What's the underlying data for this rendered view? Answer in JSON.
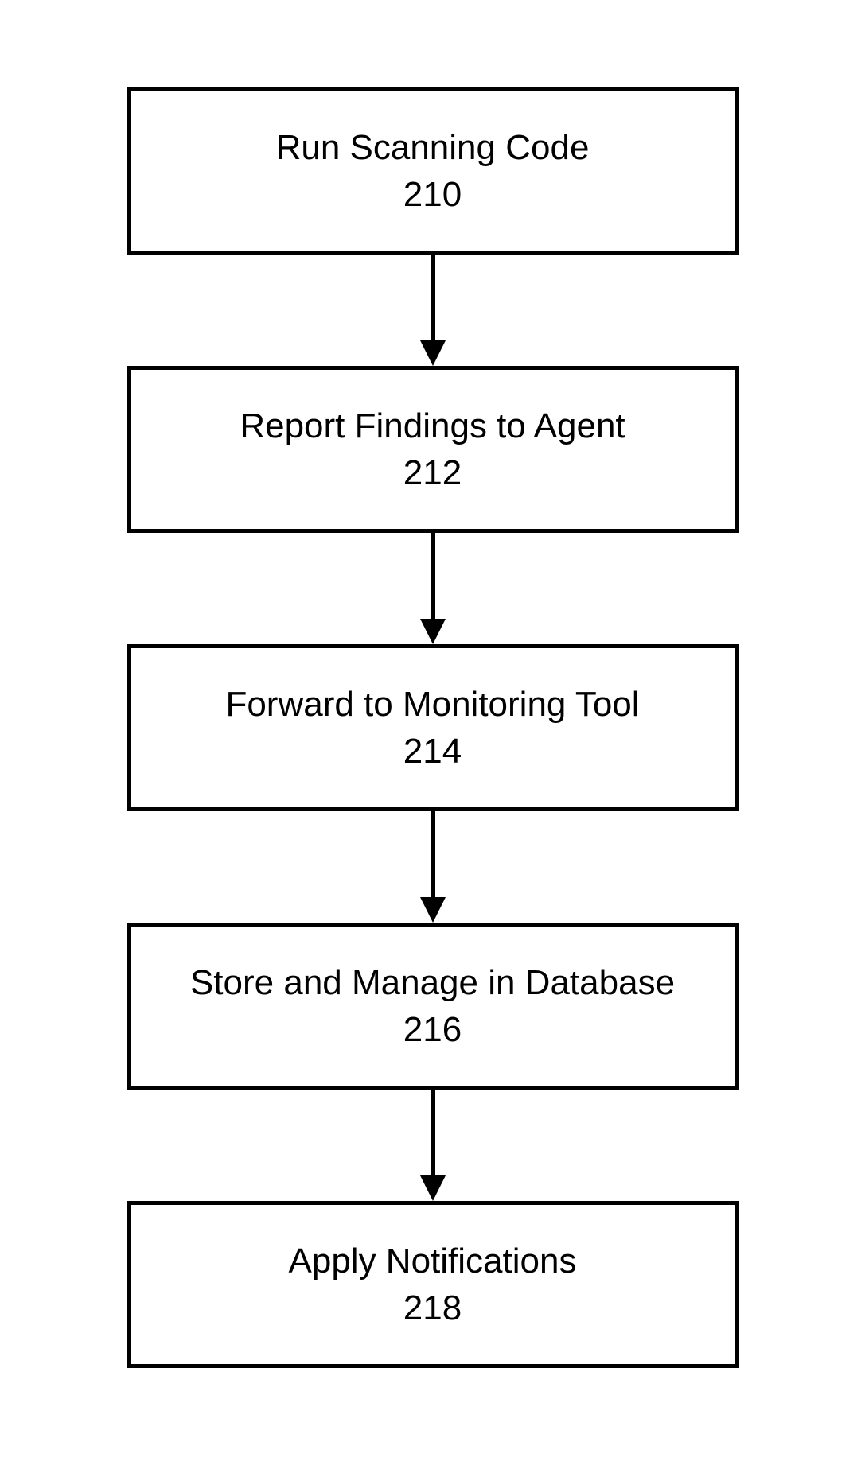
{
  "flow": {
    "steps": [
      {
        "title": "Run Scanning Code",
        "number": "210"
      },
      {
        "title": "Report Findings to Agent",
        "number": "212"
      },
      {
        "title": "Forward to Monitoring Tool",
        "number": "214"
      },
      {
        "title": "Store and Manage in Database",
        "number": "216"
      },
      {
        "title": "Apply Notifications",
        "number": "218"
      }
    ]
  }
}
